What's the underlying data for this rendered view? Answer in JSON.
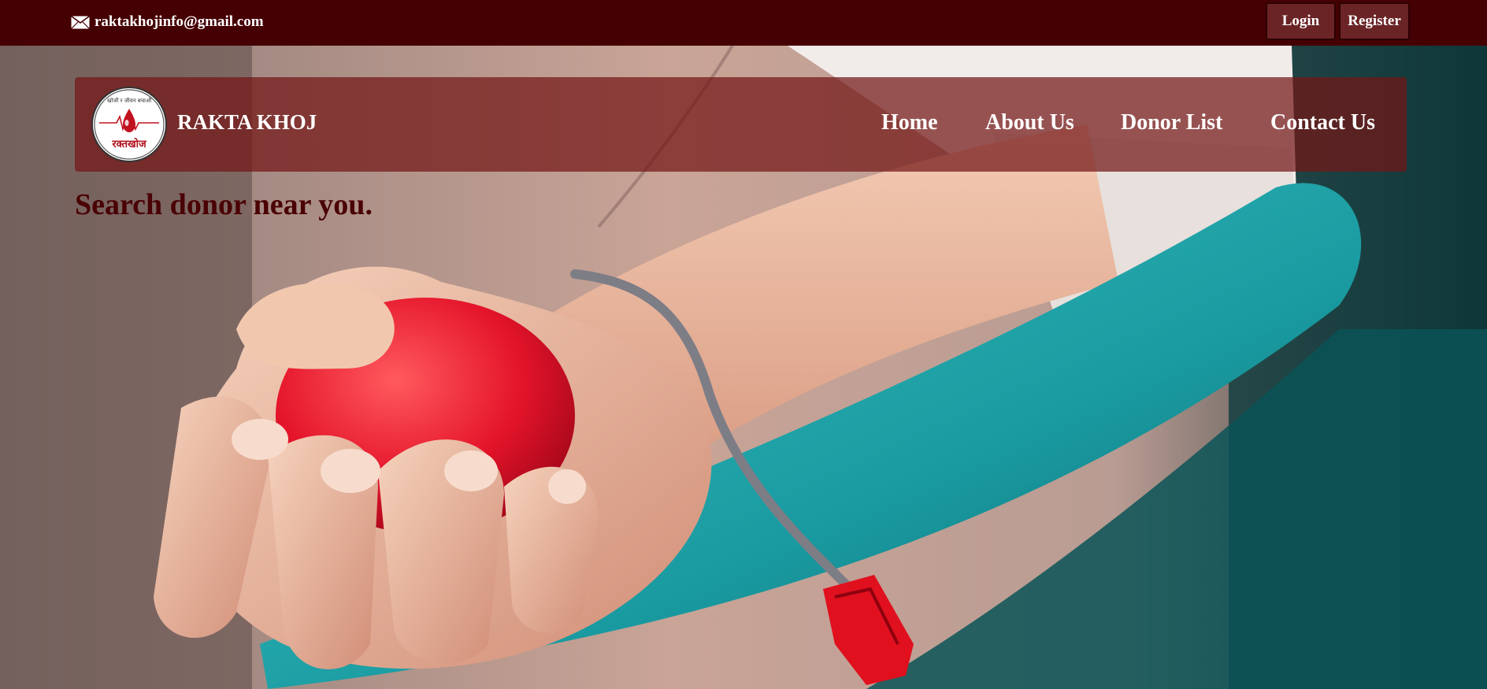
{
  "topbar": {
    "email": "raktakhojinfo@gmail.com",
    "login_label": "Login",
    "register_label": "Register",
    "mail_icon": "envelope-icon"
  },
  "navbar": {
    "logo": {
      "top_text": "खोजौं र जीवन बचाऔं",
      "bottom_text": "रक्तखोज"
    },
    "brand": "RAKTA KHOJ",
    "links": [
      "Home",
      "About Us",
      "Donor List",
      "Contact Us"
    ]
  },
  "hero": {
    "headline": "Search donor near you."
  },
  "colors": {
    "topbar_bg": "#450003",
    "navbar_bg": "rgba(115,22,22,0.72)",
    "headline": "#4a0004",
    "button_bg": "#6a2426"
  }
}
